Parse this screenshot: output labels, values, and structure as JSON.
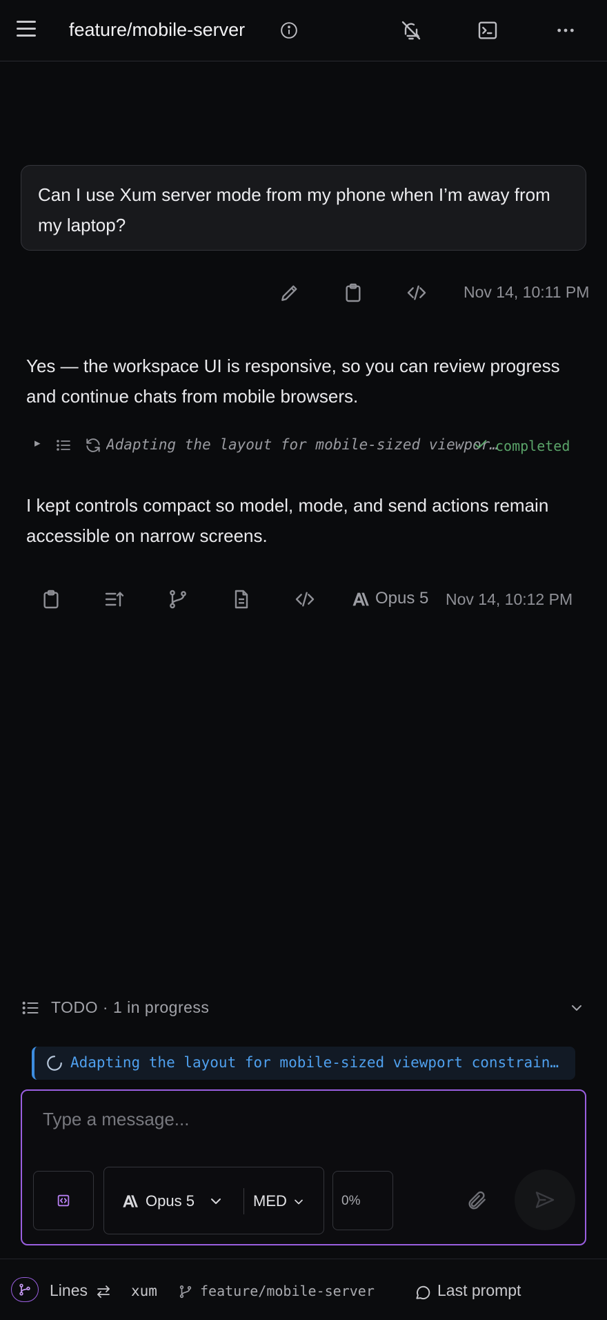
{
  "header": {
    "branch_title": "feature/mobile-server"
  },
  "user_message": {
    "text": "Can I use Xum server mode from my phone when I’m away from my laptop?",
    "timestamp": "Nov 14, 10:11 PM"
  },
  "assistant": {
    "paragraph_1": "Yes — the workspace UI is responsive, so you can review progress and continue chats from mobile browsers.",
    "tool_call": {
      "expand_glyph": "▸",
      "text": "Adapting the layout for mobile-sized viewport constraints",
      "status": "completed"
    },
    "paragraph_2": "I kept controls compact so model, mode, and send actions remain accessible on narrow screens.",
    "model": "Opus 5",
    "timestamp": "Nov 14, 10:12 PM"
  },
  "todo": {
    "label": "TODO · 1 in progress",
    "item": "Adapting the layout for mobile-sized viewport constraints"
  },
  "composer": {
    "placeholder": "Type a message...",
    "model": "Opus 5",
    "effort": "MED",
    "context_usage": "0%"
  },
  "footer": {
    "lines_label": "Lines",
    "workspace": "xum",
    "branch": "feature/mobile-server",
    "last_prompt_label": "Last prompt"
  },
  "colors": {
    "accent_purple": "#9a5fe0",
    "todo_blue": "#4fa0ee",
    "success_green": "#5aa469",
    "background": "#0a0b0d"
  }
}
